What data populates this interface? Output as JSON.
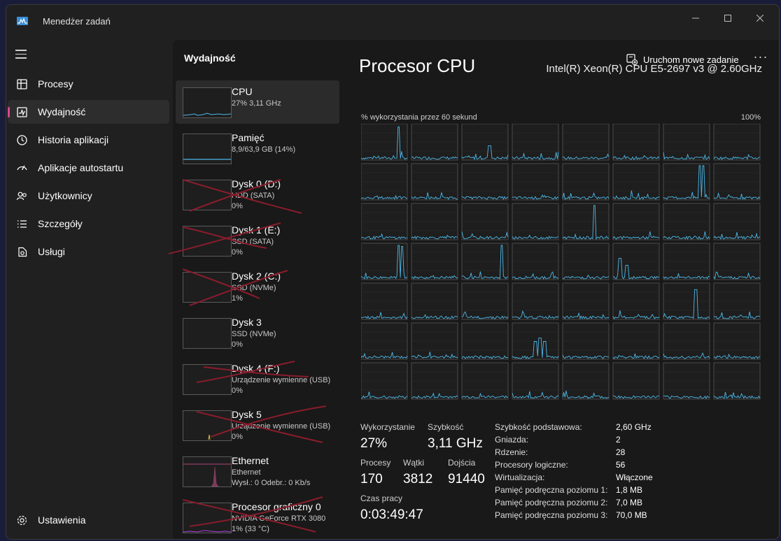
{
  "window": {
    "title": "Menedżer zadań"
  },
  "colors": {
    "accent": "#d74a8e",
    "cpu_line": "#4cb8e8",
    "memory_line": "#4cb8e8",
    "ethernet_line": "#e0569a",
    "scribble": "#8a1c2c"
  },
  "sidebar": {
    "items": [
      {
        "label": "Procesy",
        "icon": "processes-icon"
      },
      {
        "label": "Wydajność",
        "icon": "performance-icon"
      },
      {
        "label": "Historia aplikacji",
        "icon": "history-icon"
      },
      {
        "label": "Aplikacje autostartu",
        "icon": "startup-icon"
      },
      {
        "label": "Użytkownicy",
        "icon": "users-icon"
      },
      {
        "label": "Szczegóły",
        "icon": "details-icon"
      },
      {
        "label": "Usługi",
        "icon": "services-icon"
      }
    ],
    "settings_label": "Ustawienia"
  },
  "header": {
    "title": "Wydajność",
    "run_task_label": "Uruchom nowe zadanie",
    "more_label": "···"
  },
  "resources": [
    {
      "name": "CPU",
      "line2": "27%  3,11 GHz",
      "line3": ""
    },
    {
      "name": "Pamięć",
      "line2": "8,9/63,9 GB (14%)",
      "line3": ""
    },
    {
      "name": "Dysk 0 (D:)",
      "line2": "HDD (SATA)",
      "line3": "0%"
    },
    {
      "name": "Dysk 1 (E:)",
      "line2": "SSD (SATA)",
      "line3": "0%"
    },
    {
      "name": "Dysk 2 (C:)",
      "line2": "SSD (NVMe)",
      "line3": "1%"
    },
    {
      "name": "Dysk 3",
      "line2": "SSD (NVMe)",
      "line3": "0%"
    },
    {
      "name": "Dysk 4 (F:)",
      "line2": "Urządzenie wymienne (USB)",
      "line3": "0%"
    },
    {
      "name": "Dysk 5",
      "line2": "Urządzenie wymienne (USB)",
      "line3": "0%"
    },
    {
      "name": "Ethernet",
      "line2": "Ethernet",
      "line3": "Wysł.: 0  Odebr.: 0 Kb/s"
    },
    {
      "name": "Procesor graficzny 0",
      "line2": "NVIDIA GeForce RTX 3080",
      "line3": "1%  (33 °C)"
    }
  ],
  "detail": {
    "title": "Procesor CPU",
    "model": "Intel(R) Xeon(R) CPU E5-2697 v3 @ 2.60GHz",
    "util_label": "% wykorzystania przez 60 sekund",
    "util_max": "100%",
    "stats": {
      "utilization_label": "Wykorzystanie",
      "utilization": "27%",
      "speed_label": "Szybkość",
      "speed": "3,11 GHz",
      "processes_label": "Procesy",
      "processes": "170",
      "threads_label": "Wątki",
      "threads": "3812",
      "handles_label": "Dojścia",
      "handles": "91440",
      "uptime_label": "Czas pracy",
      "uptime": "0:03:49:47"
    },
    "specs": [
      {
        "label": "Szybkość podstawowa:",
        "value": "2,60 GHz"
      },
      {
        "label": "Gniazda:",
        "value": "2"
      },
      {
        "label": "Rdzenie:",
        "value": "28"
      },
      {
        "label": "Procesory logiczne:",
        "value": "56"
      },
      {
        "label": "Wirtualizacja:",
        "value": "Włączone"
      },
      {
        "label": "Pamięć podręczna poziomu 1:",
        "value": "1,8 MB"
      },
      {
        "label": "Pamięć podręczna poziomu 2:",
        "value": "7,0 MB"
      },
      {
        "label": "Pamięć podręczna poziomu 3:",
        "value": "70,0 MB"
      }
    ]
  }
}
